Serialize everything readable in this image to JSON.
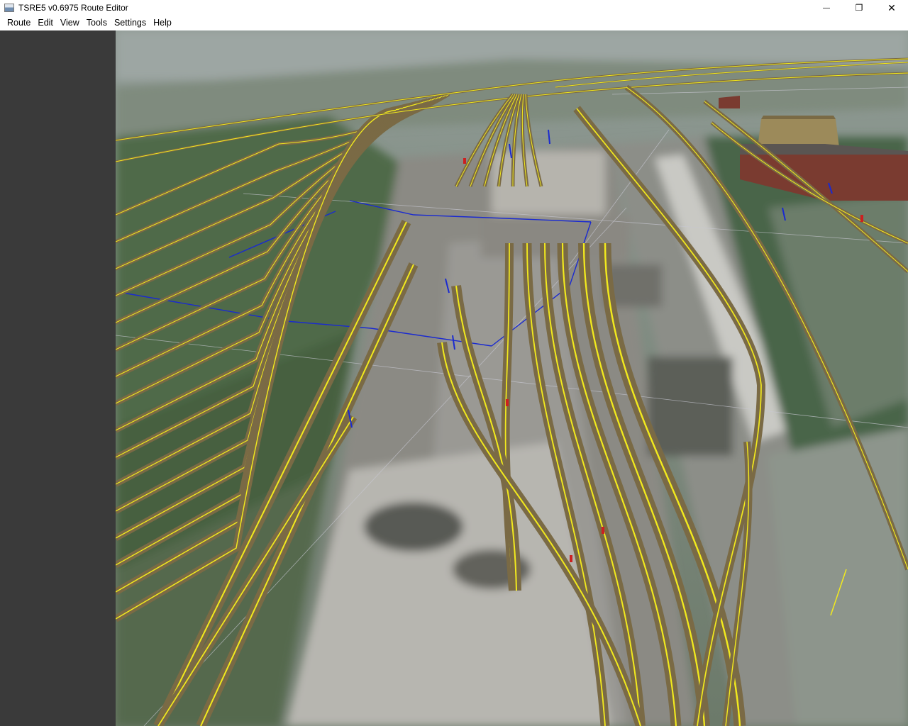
{
  "window": {
    "title": "TSRE5 v0.6975 Route Editor",
    "controls": {
      "minimize": "—",
      "restore": "❐",
      "close": "✕"
    }
  },
  "menu": {
    "items": [
      {
        "label": "Route"
      },
      {
        "label": "Edit"
      },
      {
        "label": "View"
      },
      {
        "label": "Tools"
      },
      {
        "label": "Settings"
      },
      {
        "label": "Help"
      }
    ]
  },
  "colors": {
    "sidebar": "#3a3a3a",
    "track_ballast": "#7a6a45",
    "track_center": "#f2ea1d",
    "grid_line": "#c8c8d2",
    "link_line": "#1a2ad0",
    "marker": "#cc2020"
  }
}
